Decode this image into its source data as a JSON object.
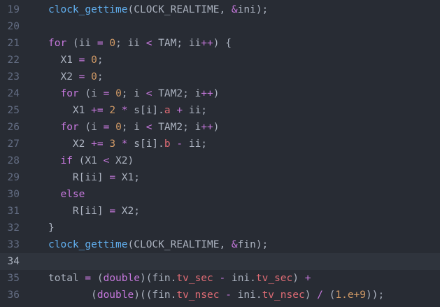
{
  "editor": {
    "colors": {
      "background": "#282c34",
      "active_line": "#2f343d",
      "gutter": "#636d83",
      "text": "#abb2bf",
      "function": "#61afef",
      "keyword": "#c678dd",
      "number": "#d19a66",
      "property": "#e06c75"
    },
    "active_line": 34,
    "lines": [
      {
        "number": "19",
        "tokens": [
          {
            "t": "fn",
            "v": "clock_gettime"
          },
          {
            "t": "plain",
            "v": "(CLOCK_REALTIME, "
          },
          {
            "t": "op",
            "v": "&"
          },
          {
            "t": "plain",
            "v": "ini);"
          }
        ]
      },
      {
        "number": "20",
        "tokens": []
      },
      {
        "number": "21",
        "tokens": [
          {
            "t": "kw",
            "v": "for"
          },
          {
            "t": "plain",
            "v": " (ii "
          },
          {
            "t": "op",
            "v": "="
          },
          {
            "t": "plain",
            "v": " "
          },
          {
            "t": "num",
            "v": "0"
          },
          {
            "t": "plain",
            "v": "; ii "
          },
          {
            "t": "op",
            "v": "<"
          },
          {
            "t": "plain",
            "v": " TAM; ii"
          },
          {
            "t": "op",
            "v": "++"
          },
          {
            "t": "plain",
            "v": ") {"
          }
        ]
      },
      {
        "number": "22",
        "tokens": [
          {
            "t": "plain",
            "v": "  X1 "
          },
          {
            "t": "op",
            "v": "="
          },
          {
            "t": "plain",
            "v": " "
          },
          {
            "t": "num",
            "v": "0"
          },
          {
            "t": "plain",
            "v": ";"
          }
        ]
      },
      {
        "number": "23",
        "tokens": [
          {
            "t": "plain",
            "v": "  X2 "
          },
          {
            "t": "op",
            "v": "="
          },
          {
            "t": "plain",
            "v": " "
          },
          {
            "t": "num",
            "v": "0"
          },
          {
            "t": "plain",
            "v": ";"
          }
        ]
      },
      {
        "number": "24",
        "tokens": [
          {
            "t": "plain",
            "v": "  "
          },
          {
            "t": "kw",
            "v": "for"
          },
          {
            "t": "plain",
            "v": " (i "
          },
          {
            "t": "op",
            "v": "="
          },
          {
            "t": "plain",
            "v": " "
          },
          {
            "t": "num",
            "v": "0"
          },
          {
            "t": "plain",
            "v": "; i "
          },
          {
            "t": "op",
            "v": "<"
          },
          {
            "t": "plain",
            "v": " TAM2; i"
          },
          {
            "t": "op",
            "v": "++"
          },
          {
            "t": "plain",
            "v": ")"
          }
        ]
      },
      {
        "number": "25",
        "tokens": [
          {
            "t": "plain",
            "v": "    X1 "
          },
          {
            "t": "op",
            "v": "+="
          },
          {
            "t": "plain",
            "v": " "
          },
          {
            "t": "num",
            "v": "2"
          },
          {
            "t": "plain",
            "v": " "
          },
          {
            "t": "op",
            "v": "*"
          },
          {
            "t": "plain",
            "v": " s[i]."
          },
          {
            "t": "prop",
            "v": "a"
          },
          {
            "t": "plain",
            "v": " "
          },
          {
            "t": "op",
            "v": "+"
          },
          {
            "t": "plain",
            "v": " ii;"
          }
        ]
      },
      {
        "number": "26",
        "tokens": [
          {
            "t": "plain",
            "v": "  "
          },
          {
            "t": "kw",
            "v": "for"
          },
          {
            "t": "plain",
            "v": " (i "
          },
          {
            "t": "op",
            "v": "="
          },
          {
            "t": "plain",
            "v": " "
          },
          {
            "t": "num",
            "v": "0"
          },
          {
            "t": "plain",
            "v": "; i "
          },
          {
            "t": "op",
            "v": "<"
          },
          {
            "t": "plain",
            "v": " TAM2; i"
          },
          {
            "t": "op",
            "v": "++"
          },
          {
            "t": "plain",
            "v": ")"
          }
        ]
      },
      {
        "number": "27",
        "tokens": [
          {
            "t": "plain",
            "v": "    X2 "
          },
          {
            "t": "op",
            "v": "+="
          },
          {
            "t": "plain",
            "v": " "
          },
          {
            "t": "num",
            "v": "3"
          },
          {
            "t": "plain",
            "v": " "
          },
          {
            "t": "op",
            "v": "*"
          },
          {
            "t": "plain",
            "v": " s[i]."
          },
          {
            "t": "prop",
            "v": "b"
          },
          {
            "t": "plain",
            "v": " "
          },
          {
            "t": "op",
            "v": "-"
          },
          {
            "t": "plain",
            "v": " ii;"
          }
        ]
      },
      {
        "number": "28",
        "tokens": [
          {
            "t": "plain",
            "v": "  "
          },
          {
            "t": "kw",
            "v": "if"
          },
          {
            "t": "plain",
            "v": " (X1 "
          },
          {
            "t": "op",
            "v": "<"
          },
          {
            "t": "plain",
            "v": " X2)"
          }
        ]
      },
      {
        "number": "29",
        "tokens": [
          {
            "t": "plain",
            "v": "    R[ii] "
          },
          {
            "t": "op",
            "v": "="
          },
          {
            "t": "plain",
            "v": " X1;"
          }
        ]
      },
      {
        "number": "30",
        "tokens": [
          {
            "t": "plain",
            "v": "  "
          },
          {
            "t": "kw",
            "v": "else"
          }
        ]
      },
      {
        "number": "31",
        "tokens": [
          {
            "t": "plain",
            "v": "    R[ii] "
          },
          {
            "t": "op",
            "v": "="
          },
          {
            "t": "plain",
            "v": " X2;"
          }
        ]
      },
      {
        "number": "32",
        "tokens": [
          {
            "t": "plain",
            "v": "}"
          }
        ]
      },
      {
        "number": "33",
        "tokens": [
          {
            "t": "fn",
            "v": "clock_gettime"
          },
          {
            "t": "plain",
            "v": "(CLOCK_REALTIME, "
          },
          {
            "t": "op",
            "v": "&"
          },
          {
            "t": "plain",
            "v": "fin);"
          }
        ]
      },
      {
        "number": "34",
        "tokens": []
      },
      {
        "number": "35",
        "tokens": [
          {
            "t": "plain",
            "v": "total "
          },
          {
            "t": "op",
            "v": "="
          },
          {
            "t": "plain",
            "v": " ("
          },
          {
            "t": "ty",
            "v": "double"
          },
          {
            "t": "plain",
            "v": ")(fin."
          },
          {
            "t": "prop",
            "v": "tv_sec"
          },
          {
            "t": "plain",
            "v": " "
          },
          {
            "t": "op",
            "v": "-"
          },
          {
            "t": "plain",
            "v": " ini."
          },
          {
            "t": "prop",
            "v": "tv_sec"
          },
          {
            "t": "plain",
            "v": ") "
          },
          {
            "t": "op",
            "v": "+"
          }
        ]
      },
      {
        "number": "36",
        "tokens": [
          {
            "t": "plain",
            "v": "       ("
          },
          {
            "t": "ty",
            "v": "double"
          },
          {
            "t": "plain",
            "v": ")((fin."
          },
          {
            "t": "prop",
            "v": "tv_nsec"
          },
          {
            "t": "plain",
            "v": " "
          },
          {
            "t": "op",
            "v": "-"
          },
          {
            "t": "plain",
            "v": " ini."
          },
          {
            "t": "prop",
            "v": "tv_nsec"
          },
          {
            "t": "plain",
            "v": ") "
          },
          {
            "t": "op",
            "v": "/"
          },
          {
            "t": "plain",
            "v": " ("
          },
          {
            "t": "num",
            "v": "1.e+9"
          },
          {
            "t": "plain",
            "v": "));"
          }
        ]
      }
    ]
  }
}
